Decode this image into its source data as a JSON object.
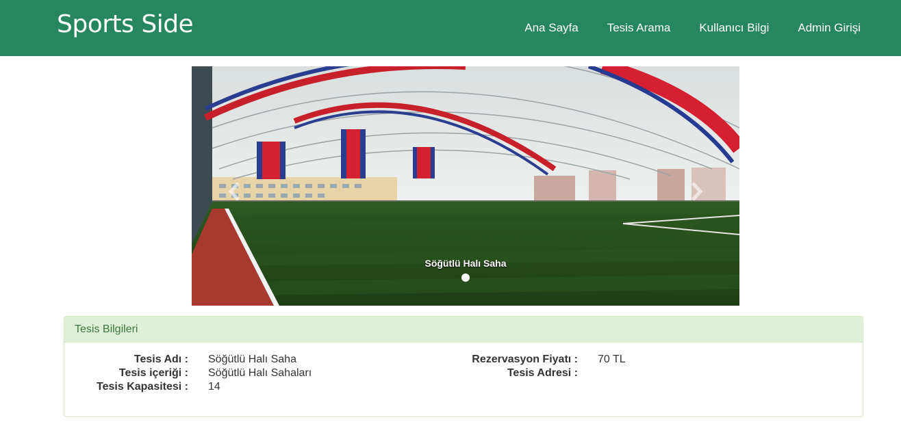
{
  "navbar": {
    "brand": "Sports Side",
    "links": [
      {
        "label": "Ana Sayfa"
      },
      {
        "label": "Tesis Arama"
      },
      {
        "label": "Kullanıcı Bilgi"
      },
      {
        "label": "Admin Girişi"
      }
    ],
    "background_color": "#258660"
  },
  "carousel": {
    "caption": "Söğütlü Halı Saha",
    "prev_icon": "chevron-left-icon",
    "next_icon": "chevron-right-icon"
  },
  "panel": {
    "title": "Tesis Bilgileri",
    "header_color": "#dff0d8",
    "left_fields": [
      {
        "label": "Tesis Adı :",
        "value": "Söğütlü Halı Saha"
      },
      {
        "label": "Tesis içeriği :",
        "value": "Söğütlü Halı Sahaları"
      },
      {
        "label": "Tesis Kapasitesi :",
        "value": "14"
      }
    ],
    "right_fields": [
      {
        "label": "Rezervasyon Fiyatı :",
        "value": "70 TL"
      },
      {
        "label": "Tesis Adresi :",
        "value": ""
      }
    ]
  }
}
